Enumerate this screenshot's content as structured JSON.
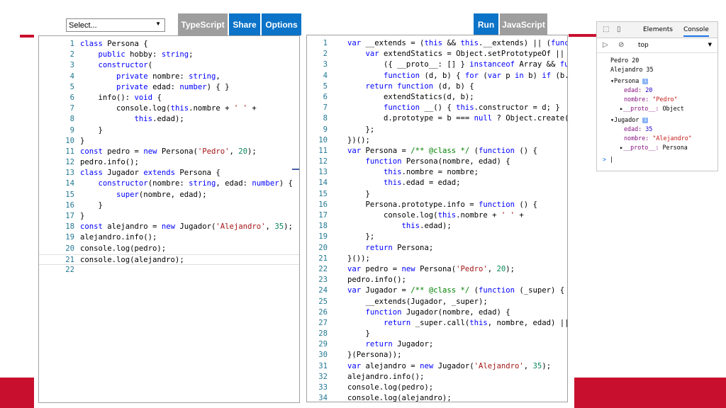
{
  "toolbar": {
    "select_value": "Select...",
    "typescript": "TypeScript",
    "share": "Share",
    "options": "Options",
    "run": "Run",
    "javascript": "JavaScript"
  },
  "left_code": [
    [
      [
        "k",
        "class "
      ],
      [
        "p",
        "Persona {"
      ]
    ],
    [
      [
        "p",
        "    "
      ],
      [
        "k",
        "public "
      ],
      [
        "p",
        "hobby: "
      ],
      [
        "k",
        "string"
      ],
      [
        "p",
        ";"
      ]
    ],
    [
      [
        "p",
        "    "
      ],
      [
        "k",
        "constructor"
      ],
      [
        "p",
        "("
      ]
    ],
    [
      [
        "p",
        "        "
      ],
      [
        "k",
        "private "
      ],
      [
        "p",
        "nombre: "
      ],
      [
        "k",
        "string"
      ],
      [
        "p",
        ","
      ]
    ],
    [
      [
        "p",
        "        "
      ],
      [
        "k",
        "private "
      ],
      [
        "p",
        "edad: "
      ],
      [
        "k",
        "number"
      ],
      [
        "p",
        ") { }"
      ]
    ],
    [
      [
        "p",
        "    info(): "
      ],
      [
        "k",
        "void"
      ],
      [
        "p",
        " {"
      ]
    ],
    [
      [
        "p",
        "        console.log("
      ],
      [
        "k",
        "this"
      ],
      [
        "p",
        ".nombre + "
      ],
      [
        "s",
        "' '"
      ],
      [
        "p",
        " +"
      ]
    ],
    [
      [
        "p",
        "            "
      ],
      [
        "k",
        "this"
      ],
      [
        "p",
        ".edad);"
      ]
    ],
    [
      [
        "p",
        "    }"
      ]
    ],
    [
      [
        "p",
        "}"
      ]
    ],
    [
      [
        "k",
        "const "
      ],
      [
        "p",
        "pedro = "
      ],
      [
        "k",
        "new "
      ],
      [
        "p",
        "Persona("
      ],
      [
        "s",
        "'Pedro'"
      ],
      [
        "p",
        ", "
      ],
      [
        "n",
        "20"
      ],
      [
        "p",
        ");"
      ]
    ],
    [
      [
        "p",
        "pedro.info();"
      ]
    ],
    [
      [
        "k",
        "class "
      ],
      [
        "p",
        "Jugador "
      ],
      [
        "k",
        "extends "
      ],
      [
        "p",
        "Persona {"
      ]
    ],
    [
      [
        "p",
        "    "
      ],
      [
        "k",
        "constructor"
      ],
      [
        "p",
        "(nombre: "
      ],
      [
        "k",
        "string"
      ],
      [
        "p",
        ", edad: "
      ],
      [
        "k",
        "number"
      ],
      [
        "p",
        ") {"
      ]
    ],
    [
      [
        "p",
        "        "
      ],
      [
        "k",
        "super"
      ],
      [
        "p",
        "(nombre, edad);"
      ]
    ],
    [
      [
        "p",
        "    }"
      ]
    ],
    [
      [
        "p",
        "}"
      ]
    ],
    [
      [
        "k",
        "const "
      ],
      [
        "p",
        "alejandro = "
      ],
      [
        "k",
        "new "
      ],
      [
        "p",
        "Jugador("
      ],
      [
        "s",
        "'Alejandro'"
      ],
      [
        "p",
        ", "
      ],
      [
        "n",
        "35"
      ],
      [
        "p",
        ");"
      ]
    ],
    [
      [
        "p",
        "alejandro.info();"
      ]
    ],
    [
      [
        "p",
        "console.log(pedro);"
      ]
    ],
    [
      [
        "p",
        "console.log(alejandro);"
      ]
    ],
    [
      [
        "p",
        ""
      ]
    ]
  ],
  "right_code": [
    [
      [
        "k",
        "var "
      ],
      [
        "p",
        "__extends = ("
      ],
      [
        "k",
        "this "
      ],
      [
        "p",
        "&& "
      ],
      [
        "k",
        "this"
      ],
      [
        "p",
        ".__extends) || ("
      ],
      [
        "k",
        "funct"
      ]
    ],
    [
      [
        "p",
        "    "
      ],
      [
        "k",
        "var "
      ],
      [
        "p",
        "extendStatics = Object.setPrototypeOf ||"
      ]
    ],
    [
      [
        "p",
        "        ({ __proto__: [] } "
      ],
      [
        "k",
        "instanceof "
      ],
      [
        "p",
        "Array && "
      ],
      [
        "k",
        "func"
      ]
    ],
    [
      [
        "p",
        "        "
      ],
      [
        "k",
        "function "
      ],
      [
        "p",
        "(d, b) { "
      ],
      [
        "k",
        "for "
      ],
      [
        "p",
        "("
      ],
      [
        "k",
        "var "
      ],
      [
        "p",
        "p "
      ],
      [
        "k",
        "in "
      ],
      [
        "p",
        "b) "
      ],
      [
        "k",
        "if "
      ],
      [
        "p",
        "(b.ha"
      ]
    ],
    [
      [
        "p",
        "    "
      ],
      [
        "k",
        "return function "
      ],
      [
        "p",
        "(d, b) {"
      ]
    ],
    [
      [
        "p",
        "        extendStatics(d, b);"
      ]
    ],
    [
      [
        "p",
        "        "
      ],
      [
        "k",
        "function "
      ],
      [
        "p",
        "__() { "
      ],
      [
        "k",
        "this"
      ],
      [
        "p",
        ".constructor = d; }"
      ]
    ],
    [
      [
        "p",
        "        d.prototype = b === "
      ],
      [
        "k",
        "null "
      ],
      [
        "p",
        "? Object.create(b"
      ]
    ],
    [
      [
        "p",
        "    };"
      ]
    ],
    [
      [
        "p",
        "})();"
      ]
    ],
    [
      [
        "k",
        "var "
      ],
      [
        "p",
        "Persona = "
      ],
      [
        "c",
        "/** @class */ "
      ],
      [
        "p",
        "("
      ],
      [
        "k",
        "function "
      ],
      [
        "p",
        "() {"
      ]
    ],
    [
      [
        "p",
        "    "
      ],
      [
        "k",
        "function "
      ],
      [
        "p",
        "Persona(nombre, edad) {"
      ]
    ],
    [
      [
        "p",
        "        "
      ],
      [
        "k",
        "this"
      ],
      [
        "p",
        ".nombre = nombre;"
      ]
    ],
    [
      [
        "p",
        "        "
      ],
      [
        "k",
        "this"
      ],
      [
        "p",
        ".edad = edad;"
      ]
    ],
    [
      [
        "p",
        "    }"
      ]
    ],
    [
      [
        "p",
        "    Persona.prototype.info = "
      ],
      [
        "k",
        "function "
      ],
      [
        "p",
        "() {"
      ]
    ],
    [
      [
        "p",
        "        console.log("
      ],
      [
        "k",
        "this"
      ],
      [
        "p",
        ".nombre + "
      ],
      [
        "s",
        "' '"
      ],
      [
        "p",
        " +"
      ]
    ],
    [
      [
        "p",
        "            "
      ],
      [
        "k",
        "this"
      ],
      [
        "p",
        ".edad);"
      ]
    ],
    [
      [
        "p",
        "    };"
      ]
    ],
    [
      [
        "p",
        "    "
      ],
      [
        "k",
        "return "
      ],
      [
        "p",
        "Persona;"
      ]
    ],
    [
      [
        "p",
        "}());"
      ]
    ],
    [
      [
        "k",
        "var "
      ],
      [
        "p",
        "pedro = "
      ],
      [
        "k",
        "new "
      ],
      [
        "p",
        "Persona("
      ],
      [
        "s",
        "'Pedro'"
      ],
      [
        "p",
        ", "
      ],
      [
        "n",
        "20"
      ],
      [
        "p",
        ");"
      ]
    ],
    [
      [
        "p",
        "pedro.info();"
      ]
    ],
    [
      [
        "k",
        "var "
      ],
      [
        "p",
        "Jugador = "
      ],
      [
        "c",
        "/** @class */ "
      ],
      [
        "p",
        "("
      ],
      [
        "k",
        "function "
      ],
      [
        "p",
        "(_super) {"
      ]
    ],
    [
      [
        "p",
        "    __extends(Jugador, _super);"
      ]
    ],
    [
      [
        "p",
        "    "
      ],
      [
        "k",
        "function "
      ],
      [
        "p",
        "Jugador(nombre, edad) {"
      ]
    ],
    [
      [
        "p",
        "        "
      ],
      [
        "k",
        "return "
      ],
      [
        "p",
        "_super.call("
      ],
      [
        "k",
        "this"
      ],
      [
        "p",
        ", nombre, edad) || "
      ],
      [
        "k",
        "t"
      ]
    ],
    [
      [
        "p",
        "    }"
      ]
    ],
    [
      [
        "p",
        "    "
      ],
      [
        "k",
        "return "
      ],
      [
        "p",
        "Jugador;"
      ]
    ],
    [
      [
        "p",
        "}(Persona));"
      ]
    ],
    [
      [
        "k",
        "var "
      ],
      [
        "p",
        "alejandro = "
      ],
      [
        "k",
        "new "
      ],
      [
        "p",
        "Jugador("
      ],
      [
        "s",
        "'Alejandro'"
      ],
      [
        "p",
        ", "
      ],
      [
        "n",
        "35"
      ],
      [
        "p",
        ");"
      ]
    ],
    [
      [
        "p",
        "alejandro.info();"
      ]
    ],
    [
      [
        "p",
        "console.log(pedro);"
      ]
    ],
    [
      [
        "p",
        "console.log(alejandro);"
      ]
    ]
  ],
  "devtools": {
    "tab_elements": "Elements",
    "tab_console": "Console",
    "context": "top",
    "out_pedro": "Pedro 20",
    "out_alejandro": "Alejandro 35",
    "obj1_name": "Persona",
    "obj1_edad_key": "edad:",
    "obj1_edad_val": "20",
    "obj1_nombre_key": "nombre:",
    "obj1_nombre_val": "\"Pedro\"",
    "obj1_proto_key": "__proto__:",
    "obj1_proto_val": "Object",
    "obj2_name": "Jugador",
    "obj2_edad_key": "edad:",
    "obj2_edad_val": "35",
    "obj2_nombre_key": "nombre:",
    "obj2_nombre_val": "\"Alejandro\"",
    "obj2_proto_key": "__proto__:",
    "obj2_proto_val": "Persona",
    "info_badge": "i",
    "prompt": ">"
  }
}
